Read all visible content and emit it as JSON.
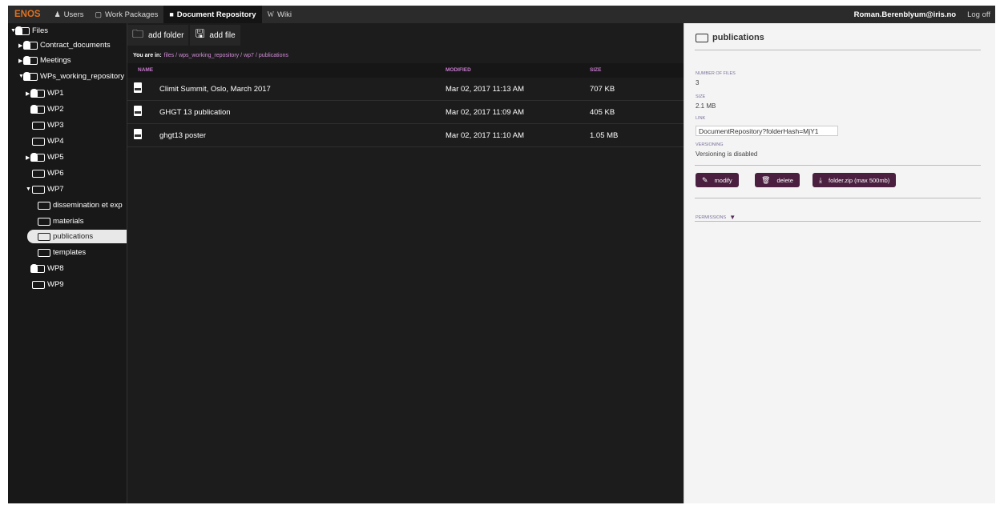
{
  "nav": {
    "brand": "ENOS",
    "items": [
      {
        "icon": "♟",
        "label": "Users"
      },
      {
        "icon": "▢",
        "label": "Work Packages"
      },
      {
        "icon": "■",
        "label": "Document Repository"
      },
      {
        "icon": "W",
        "label": "Wiki"
      }
    ],
    "user": "Roman.Berenblyum@iris.no",
    "logoff": "Log off"
  },
  "tree": {
    "files": "Files",
    "contract": "Contract_documents",
    "meetings": "Meetings",
    "wps": "WPs_working_repository",
    "wp1": "WP1",
    "wp2": "WP2",
    "wp3": "WP3",
    "wp4": "WP4",
    "wp5": "WP5",
    "wp6": "WP6",
    "wp7": "WP7",
    "dissemination": "dissemination et exp",
    "materials": "materials",
    "publications": "publications",
    "templates": "templates",
    "wp8": "WP8",
    "wp9": "WP9"
  },
  "toolbar": {
    "add_folder": "add folder",
    "add_file": "add file"
  },
  "breadcrumb": {
    "label": "You are in:",
    "parts": [
      "files",
      "wps_working_repository",
      "wp7",
      "publications"
    ]
  },
  "table": {
    "headers": {
      "name": "NAME",
      "modified": "MODIFIED",
      "size": "SIZE"
    },
    "rows": [
      {
        "name": "Climit Summit, Oslo, March 2017",
        "modified": "Mar 02, 2017 11:13 AM",
        "size": "707 KB"
      },
      {
        "name": "GHGT 13 publication",
        "modified": "Mar 02, 2017 11:09 AM",
        "size": "405 KB"
      },
      {
        "name": "ghgt13 poster",
        "modified": "Mar 02, 2017 11:10 AM",
        "size": "1.05 MB"
      }
    ]
  },
  "details": {
    "title": "publications",
    "num_files_label": "NUMBER OF FILES",
    "num_files": "3",
    "size_label": "SIZE",
    "size": "2.1 MB",
    "link_label": "LINK",
    "link": "DocumentRepository?folderHash=MjY1",
    "versioning_label": "VERSIONING",
    "versioning": "Versioning is disabled",
    "modify": "modify",
    "delete": "delete",
    "zip": "folder.zip (max 500mb)",
    "permissions": "PERMISSIONS"
  },
  "colors": {
    "accent": "#e0701f",
    "link": "#d08bd6",
    "button": "#4a1f3f"
  }
}
